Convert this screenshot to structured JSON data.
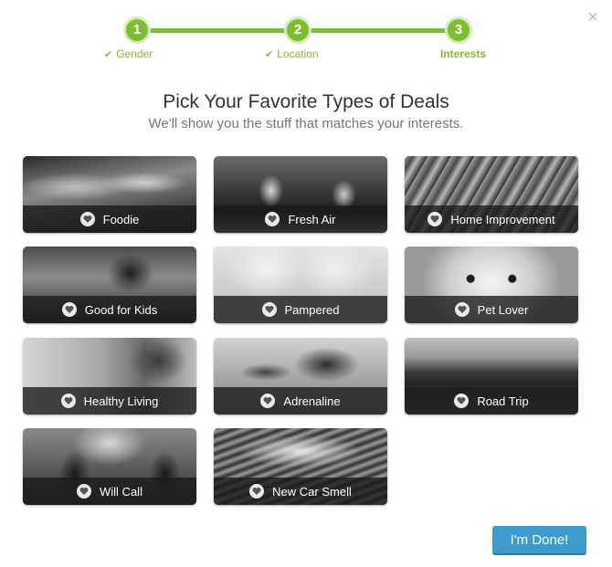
{
  "close_icon": "×",
  "steps": [
    {
      "number": "1",
      "label": "Gender",
      "done": true
    },
    {
      "number": "2",
      "label": "Location",
      "done": true
    },
    {
      "number": "3",
      "label": "Interests",
      "done": false
    }
  ],
  "check_glyph": "✔",
  "title": "Pick Your Favorite Types of Deals",
  "subtitle": "We'll show you the stuff that matches your interests.",
  "categories": [
    {
      "label": "Foodie"
    },
    {
      "label": "Fresh Air"
    },
    {
      "label": "Home Improvement"
    },
    {
      "label": "Good for Kids"
    },
    {
      "label": "Pampered"
    },
    {
      "label": "Pet Lover"
    },
    {
      "label": "Healthy Living"
    },
    {
      "label": "Adrenaline"
    },
    {
      "label": "Road Trip"
    },
    {
      "label": "Will Call"
    },
    {
      "label": "New Car Smell"
    }
  ],
  "done_button": "I'm Done!",
  "colors": {
    "accent_green": "#7dbf2f",
    "button_blue": "#3b9ccd"
  }
}
